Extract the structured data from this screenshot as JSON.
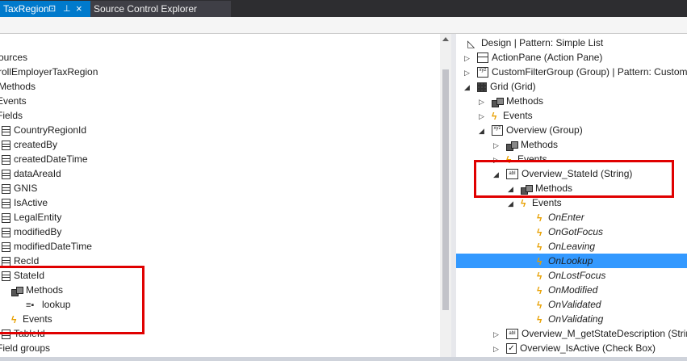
{
  "tabs": {
    "active_label": "TaxRegion",
    "pin_glyph": "⊡",
    "dock_glyph": "⊥",
    "close_glyph": "×",
    "inactive_label": "Source Control Explorer"
  },
  "left_tree": {
    "items": [
      {
        "label": "ources"
      },
      {
        "label": "rollEmployerTaxRegion"
      },
      {
        "label": "Methods"
      },
      {
        "label": "Events"
      },
      {
        "label": "Fields"
      },
      {
        "label": "CountryRegionId"
      },
      {
        "label": "createdBy"
      },
      {
        "label": "createdDateTime"
      },
      {
        "label": "dataAreaId"
      },
      {
        "label": "GNIS"
      },
      {
        "label": "IsActive"
      },
      {
        "label": "LegalEntity"
      },
      {
        "label": "modifiedBy"
      },
      {
        "label": "modifiedDateTime"
      },
      {
        "label": "RecId"
      },
      {
        "label": "StateId"
      },
      {
        "label": "Methods"
      },
      {
        "label": "lookup"
      },
      {
        "label": "Events"
      },
      {
        "label": "TableId"
      },
      {
        "label": "Field groups"
      }
    ]
  },
  "right_tree": {
    "items": [
      {
        "label": "Design | Pattern: Simple List"
      },
      {
        "label": "ActionPane (Action Pane)"
      },
      {
        "label": "CustomFilterGroup (Group) | Pattern: Custom"
      },
      {
        "label": "Grid (Grid)"
      },
      {
        "label": "Methods"
      },
      {
        "label": "Events"
      },
      {
        "label": "Overview (Group)"
      },
      {
        "label": "Methods"
      },
      {
        "label": "Events"
      },
      {
        "label": "Overview_StateId (String)"
      },
      {
        "label": "Methods"
      },
      {
        "label": "Events"
      },
      {
        "label": "OnEnter"
      },
      {
        "label": "OnGotFocus"
      },
      {
        "label": "OnLeaving"
      },
      {
        "label": "OnLookup"
      },
      {
        "label": "OnLostFocus"
      },
      {
        "label": "OnModified"
      },
      {
        "label": "OnValidated"
      },
      {
        "label": "OnValidating"
      },
      {
        "label": "Overview_M_getStateDescription (String)"
      },
      {
        "label": "Overview_IsActive (Check Box)"
      }
    ],
    "selected": "OnLookup"
  },
  "colors": {
    "accent": "#007acc",
    "selection": "#3399ff",
    "highlight_box": "#e00000",
    "event_icon": "#e8a000"
  }
}
